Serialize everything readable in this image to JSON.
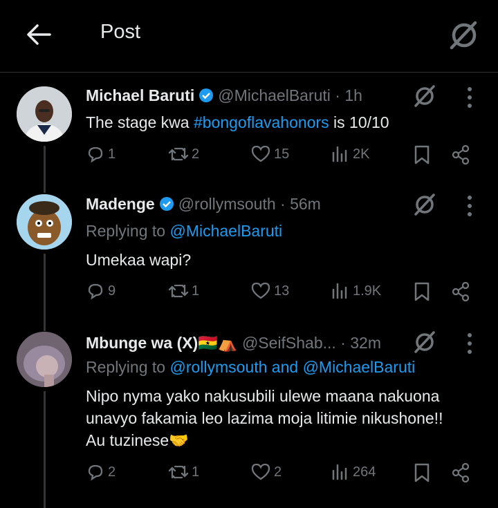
{
  "header": {
    "title": "Post"
  },
  "tweets": [
    {
      "name": "Michael Baruti",
      "handle": "@MichaelBaruti",
      "time": "· 1h",
      "text_pre": "The stage kwa ",
      "hashtag": "#bongoflavahonors",
      "text_post": " is 10/10",
      "replies": "1",
      "reposts": "2",
      "likes": "15",
      "views": "2K"
    },
    {
      "name": "Madenge",
      "handle": "@rollymsouth",
      "time": "· 56m",
      "replying_label": "Replying to ",
      "replying_to": "@MichaelBaruti",
      "text": "Umekaa wapi?",
      "replies": "9",
      "reposts": "1",
      "likes": "13",
      "views": "1.9K"
    },
    {
      "name": "Mbunge wa (X)🇬🇭⛺",
      "handle": "@SeifShab...",
      "time": "· 32m",
      "replying_label": "Replying to ",
      "replying_to": "@rollymsouth and @MichaelBaruti",
      "text_line1": "Nipo nyma yako nakusubili ulewe maana nakuona",
      "text_line2": "unavyo fakamia leo lazima moja litimie nikushone!!",
      "text_line3": "Au tuzinese🤝",
      "replies": "2",
      "reposts": "1",
      "likes": "2",
      "views": "264"
    }
  ],
  "colors": {
    "link": "#1d9bf0",
    "muted": "#71767b",
    "verified": "#1d9bf0"
  }
}
